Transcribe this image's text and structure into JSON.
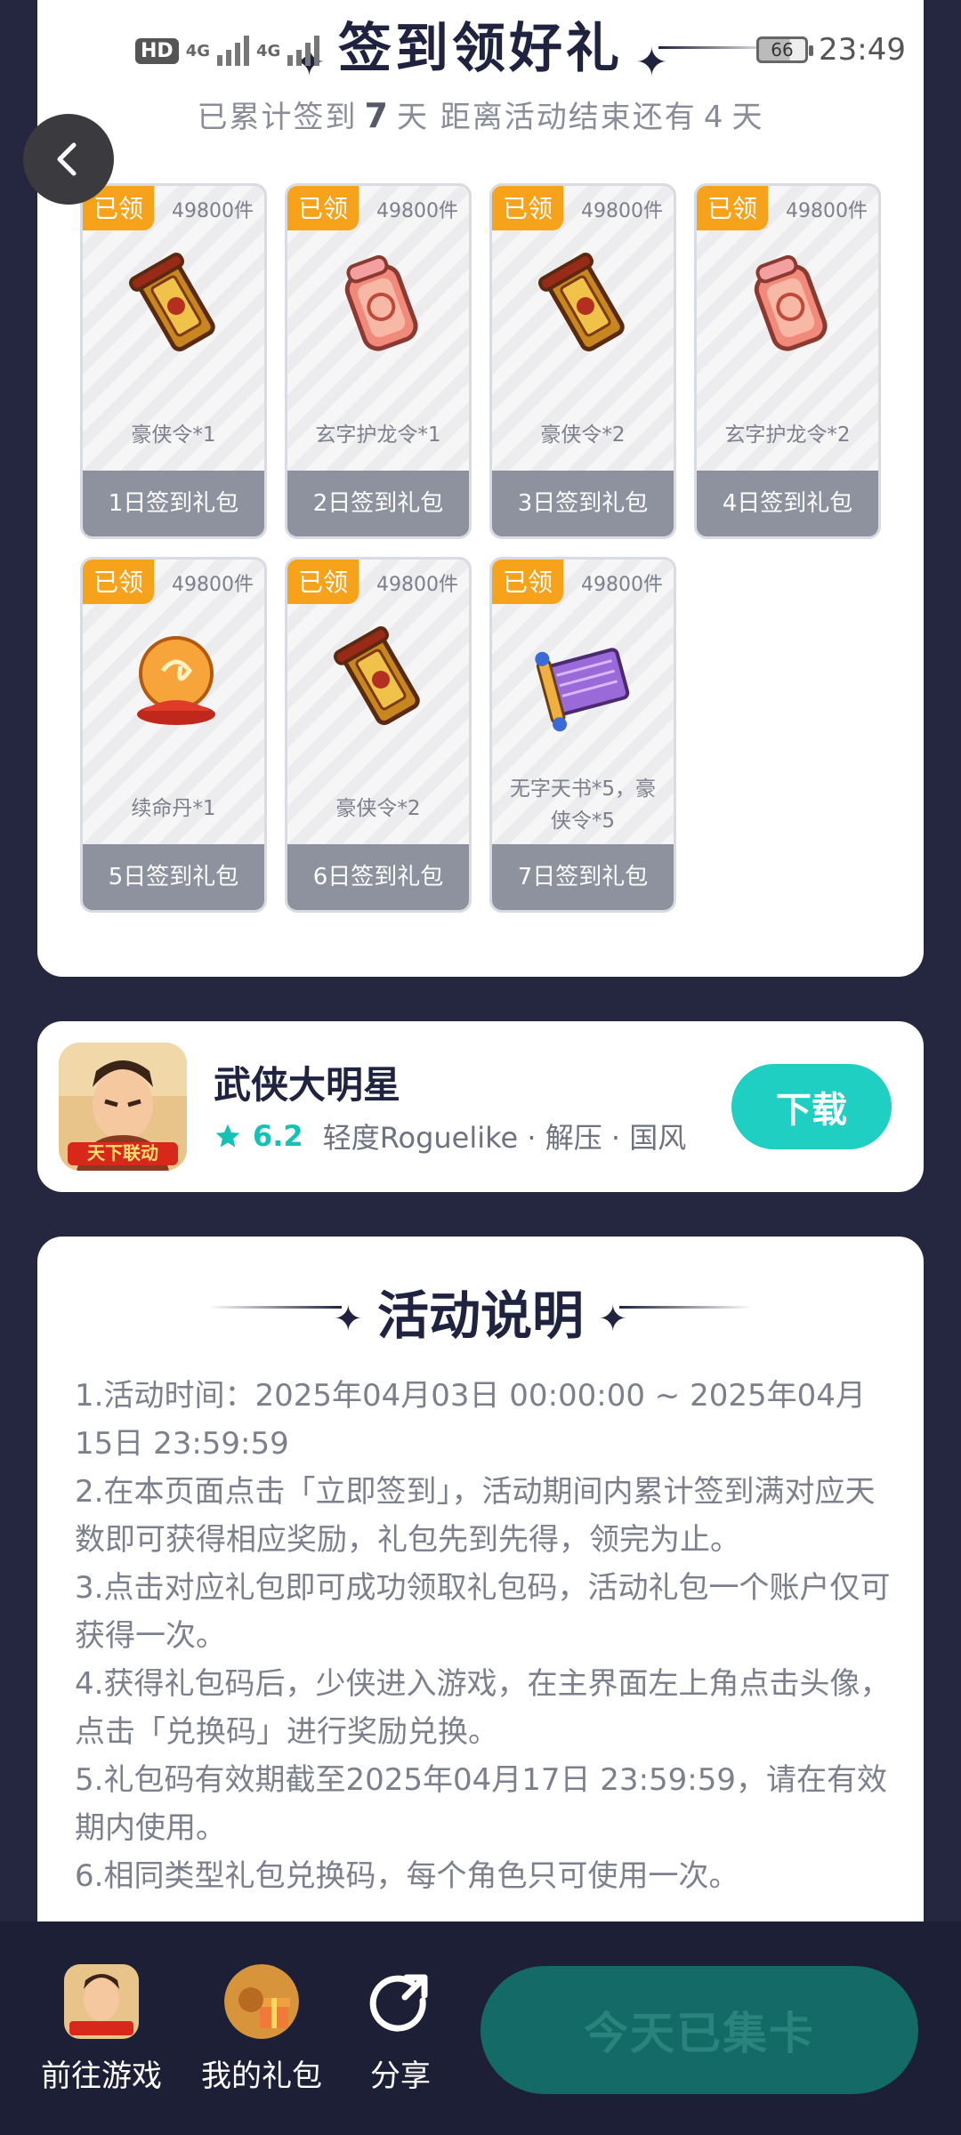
{
  "status_bar": {
    "hd": "HD",
    "network_1": "4G",
    "network_2": "4G",
    "battery": "66",
    "time": "23:49"
  },
  "header": {
    "title": "签到领好礼",
    "subtitle_prefix": "已累计签到",
    "days_signed": "7",
    "subtitle_mid": "天  距离活动结束还有",
    "days_left": "4",
    "subtitle_suffix": "天"
  },
  "gifts": [
    {
      "tag": "已领",
      "count": "49800件",
      "name": "豪侠令*1",
      "day": "1日签到礼包",
      "icon": "token-gold-icon"
    },
    {
      "tag": "已领",
      "count": "49800件",
      "name": "玄字护龙令*1",
      "day": "2日签到礼包",
      "icon": "token-pink-icon"
    },
    {
      "tag": "已领",
      "count": "49800件",
      "name": "豪侠令*2",
      "day": "3日签到礼包",
      "icon": "token-gold-icon"
    },
    {
      "tag": "已领",
      "count": "49800件",
      "name": "玄字护龙令*2",
      "day": "4日签到礼包",
      "icon": "token-pink-icon"
    },
    {
      "tag": "已领",
      "count": "49800件",
      "name": "续命丹*1",
      "day": "5日签到礼包",
      "icon": "elixir-orb-icon"
    },
    {
      "tag": "已领",
      "count": "49800件",
      "name": "豪侠令*2",
      "day": "6日签到礼包",
      "icon": "token-gold-icon"
    },
    {
      "tag": "已领",
      "count": "49800件",
      "name": "无字天书*5，豪侠令*5",
      "day": "7日签到礼包",
      "icon": "scroll-icon"
    }
  ],
  "game": {
    "name": "武侠大明星",
    "rating": "6.2",
    "tags": "轻度Roguelike · 解压 · 国风",
    "download_label": "下载",
    "icon_text": "天下联动"
  },
  "rules": {
    "title": "活动说明",
    "items": [
      "1.活动时间：2025年04月03日 00:00:00 ~ 2025年04月15日 23:59:59",
      "2.在本页面点击「立即签到」，活动期间内累计签到满对应天数即可获得相应奖励，礼包先到先得，领完为止。",
      "3.点击对应礼包即可成功领取礼包码，活动礼包一个账户仅可获得一次。",
      "4.获得礼包码后，少侠进入游戏，在主界面左上角点击头像，点击「兑换码」进行奖励兑换。",
      "5.礼包码有效期截至2025年04月17日 23:59:59，请在有效期内使用。",
      "6.相同类型礼包兑换码，每个角色只可使用一次。"
    ]
  },
  "bottom": {
    "goto_game": "前往游戏",
    "my_gifts": "我的礼包",
    "share": "分享",
    "collect_button": "今天已集卡"
  },
  "colors": {
    "accent": "#1fd0c2",
    "tag": "#f7a21b",
    "page_bg": "#24273f"
  }
}
